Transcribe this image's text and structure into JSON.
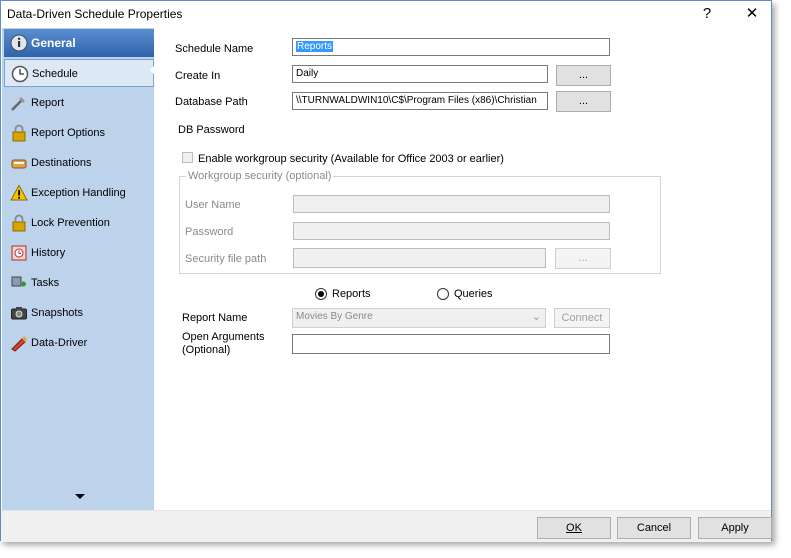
{
  "window": {
    "title": "Data-Driven Schedule Properties",
    "help_label": "?",
    "close_label": "✕"
  },
  "sidebar": {
    "items": [
      {
        "label": "General",
        "icon": "info-icon"
      },
      {
        "label": "Schedule",
        "icon": "clock-icon"
      },
      {
        "label": "Report",
        "icon": "report-icon"
      },
      {
        "label": "Report Options",
        "icon": "lock-icon"
      },
      {
        "label": "Destinations",
        "icon": "destination-icon"
      },
      {
        "label": "Exception Handling",
        "icon": "warning-icon"
      },
      {
        "label": "Lock Prevention",
        "icon": "lock-icon"
      },
      {
        "label": "History",
        "icon": "history-icon"
      },
      {
        "label": "Tasks",
        "icon": "tasks-icon"
      },
      {
        "label": "Snapshots",
        "icon": "camera-icon"
      },
      {
        "label": "Data-Driver",
        "icon": "data-driver-icon"
      }
    ]
  },
  "form": {
    "schedule_name_label": "Schedule Name",
    "schedule_name_value": "Reports",
    "create_in_label": "Create In",
    "create_in_value": "Daily",
    "browse_label": "...",
    "database_path_label": "Database Path",
    "database_path_value": "\\\\TURNWALDWIN10\\C$\\Program Files (x86)\\Christian",
    "db_password_label": "DB Password",
    "workgroup_checkbox_label": "Enable workgroup security (Available for Office 2003 or earlier)",
    "workgroup_group_title": "Workgroup security (optional)",
    "user_name_label": "User Name",
    "password_label": "Password",
    "security_file_label": "Security file path",
    "security_browse_label": "...",
    "radio_reports_label": "Reports",
    "radio_queries_label": "Queries",
    "report_name_label": "Report Name",
    "report_name_value": "Movies By Genre",
    "connect_label": "Connect",
    "open_args_label_1": "Open Arguments",
    "open_args_label_2": "(Optional)",
    "open_args_value": ""
  },
  "footer": {
    "ok_label": "OK",
    "cancel_label": "Cancel",
    "apply_label": "Apply"
  }
}
